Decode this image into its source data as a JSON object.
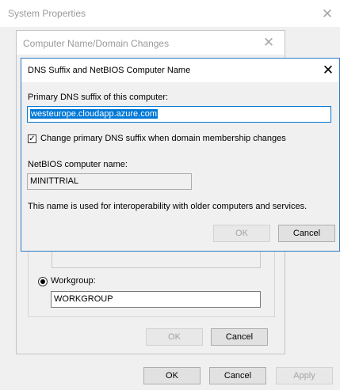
{
  "system_properties": {
    "title": "System Properties",
    "close_glyph": "✕",
    "buttons": {
      "ok": "OK",
      "cancel": "Cancel",
      "apply": "Apply"
    }
  },
  "domain_changes": {
    "title": "Computer Name/Domain Changes",
    "close_glyph": "✕",
    "workgroup_label": "Workgroup:",
    "workgroup_value": "WORKGROUP",
    "buttons": {
      "ok": "OK",
      "cancel": "Cancel"
    }
  },
  "dns_dialog": {
    "title": "DNS Suffix and NetBIOS Computer Name",
    "close_glyph": "✕",
    "primary_dns_label": "Primary DNS suffix of this computer:",
    "primary_dns_value": "westeurope.cloudapp.azure.com",
    "checkbox_label": "Change primary DNS suffix when domain membership changes",
    "checkbox_checked": true,
    "checkbox_glyph": "✓",
    "netbios_label": "NetBIOS computer name:",
    "netbios_value": "MINITTRIAL",
    "info_text": "This name is used for interoperability with older computers and services.",
    "buttons": {
      "ok": "OK",
      "cancel": "Cancel"
    }
  },
  "colors": {
    "accent": "#0078d7",
    "dialog_border": "#2b79c2",
    "window_bg": "#f0f0f0"
  }
}
